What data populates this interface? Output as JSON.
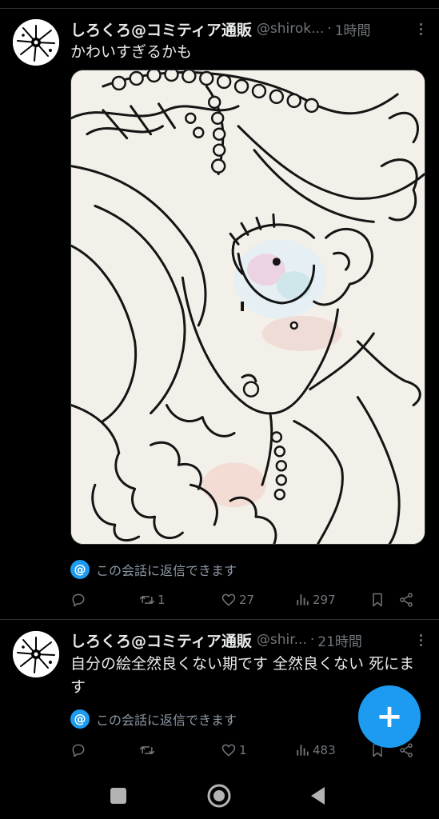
{
  "feed": {
    "tweets": [
      {
        "display_name": "しろくろ@コミティア通販",
        "handle": "@shirok...",
        "separator": "·",
        "time": "1時間",
        "text": "かわいすぎるかも",
        "has_media": true,
        "media_icon": "illustration-line-art",
        "reply_restriction": "この会話に返信できます",
        "replies": "",
        "retweets": "1",
        "likes": "27",
        "views": "297"
      },
      {
        "display_name": "しろくろ@コミティア通販",
        "handle": "@shir...",
        "separator": "·",
        "time": "21時間",
        "text": "自分の絵全然良くない期です 全然良くない 死にます",
        "has_media": false,
        "reply_restriction": "この会話に返信できます",
        "replies": "",
        "retweets": "",
        "likes": "1",
        "views": "483"
      }
    ]
  },
  "fab": {
    "label": "+",
    "icon": "compose-plus-icon"
  },
  "navbar": {
    "icons": [
      "recents-square-icon",
      "home-circle-icon",
      "back-triangle-icon"
    ]
  },
  "colors": {
    "accent": "#1d9bf0",
    "background": "#000000",
    "text": "#e7e9ea",
    "muted": "#71767b",
    "divider": "#2f3336"
  }
}
